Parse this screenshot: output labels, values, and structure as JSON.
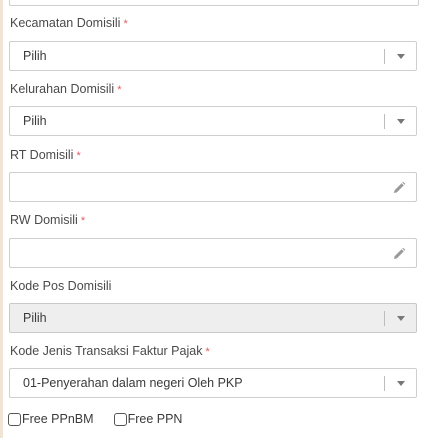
{
  "form": {
    "kecamatan": {
      "label": "Kecamatan Domisili",
      "required_mark": "*",
      "value": "Pilih"
    },
    "kelurahan": {
      "label": "Kelurahan Domisili",
      "required_mark": "*",
      "value": "Pilih"
    },
    "rt": {
      "label": "RT Domisili",
      "required_mark": "*",
      "value": ""
    },
    "rw": {
      "label": "RW Domisili",
      "required_mark": "*",
      "value": ""
    },
    "kode_pos": {
      "label": "Kode Pos Domisili",
      "value": "Pilih",
      "disabled": true
    },
    "kode_jenis_transaksi": {
      "label": "Kode Jenis Transaksi Faktur Pajak",
      "required_mark": "*",
      "value": "01-Penyerahan dalam negeri Oleh PKP"
    },
    "checkboxes": [
      {
        "label": "Free PPnBM",
        "checked": false
      },
      {
        "label": "Free PPN",
        "checked": false
      }
    ]
  },
  "icons": {
    "select_arrow": "chevron-down-icon",
    "edit": "pencil-icon"
  },
  "colors": {
    "required": "#e05b5b",
    "disabled_bg": "#eeeeee",
    "border": "#cfcfcf"
  }
}
